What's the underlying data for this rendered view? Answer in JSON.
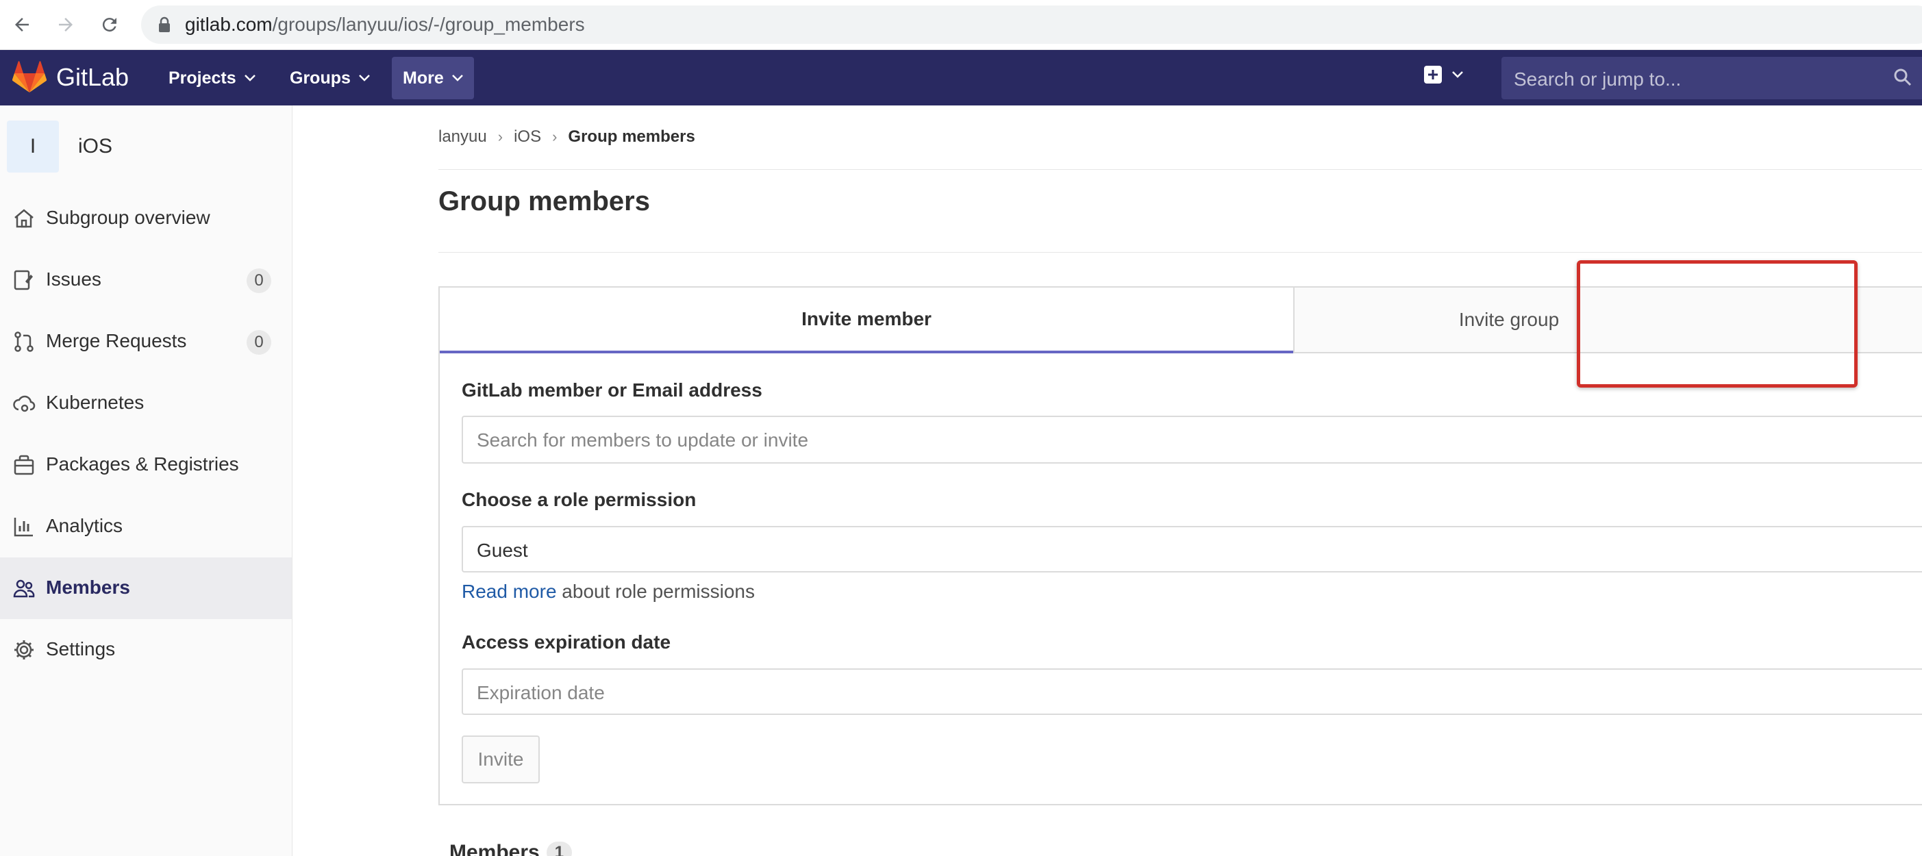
{
  "browser": {
    "url_host": "gitlab.com",
    "url_path": "/groups/lanyuu/ios/-/group_members"
  },
  "topnav": {
    "logo_text": "GitLab",
    "items": [
      {
        "label": "Projects"
      },
      {
        "label": "Groups"
      },
      {
        "label": "More"
      }
    ],
    "search_placeholder": "Search or jump to..."
  },
  "sidebar": {
    "avatar_letter": "I",
    "project_name": "iOS",
    "items": [
      {
        "label": "Subgroup overview",
        "icon": "home-icon"
      },
      {
        "label": "Issues",
        "icon": "issues-icon",
        "badge": "0"
      },
      {
        "label": "Merge Requests",
        "icon": "merge-request-icon",
        "badge": "0"
      },
      {
        "label": "Kubernetes",
        "icon": "cloud-gear-icon"
      },
      {
        "label": "Packages & Registries",
        "icon": "package-icon"
      },
      {
        "label": "Analytics",
        "icon": "chart-icon"
      },
      {
        "label": "Members",
        "icon": "users-icon",
        "active": true
      },
      {
        "label": "Settings",
        "icon": "settings-icon"
      }
    ]
  },
  "breadcrumb": [
    "lanyuu",
    "iOS",
    "Group members"
  ],
  "page": {
    "title": "Group members"
  },
  "tabs": {
    "invite_member": "Invite member",
    "invite_group": "Invite group"
  },
  "form": {
    "member_label": "GitLab member or Email address",
    "member_placeholder": "Search for members to update or invite",
    "role_label": "Choose a role permission",
    "role_value": "Guest",
    "read_more": "Read more",
    "read_more_suffix": " about role permissions",
    "expiration_label": "Access expiration date",
    "expiration_placeholder": "Expiration date",
    "invite_button": "Invite"
  },
  "members": {
    "heading": "Members",
    "count": "1"
  },
  "colors": {
    "nav_bg": "#292961",
    "highlight": "#d0302a",
    "tab_underline": "#6666c4"
  }
}
